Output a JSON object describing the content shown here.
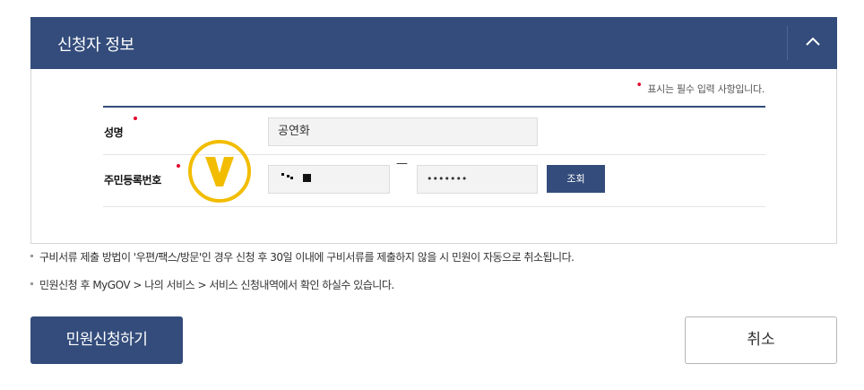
{
  "section": {
    "title": "신청자 정보",
    "collapse_icon": "chevron-up-icon"
  },
  "form": {
    "required_note": "표시는 필수 입력 사항입니다.",
    "name_label": "성명",
    "name_value": "공연화",
    "rrn_label": "주민등록번호",
    "rrn_separator": "—",
    "rrn_back_value": "•••••••",
    "lookup_button": "조회"
  },
  "badge": {
    "icon": "v-check-badge-icon",
    "letter": "V",
    "color": "#f2bd00"
  },
  "notices": [
    "구비서류 제출 방법이 '우편/팩스/방문'인 경우 신청 후 30일 이내에 구비서류를 제출하지 않을 시 민원이 자동으로 취소됩니다.",
    "민원신청 후 MyGOV > 나의 서비스 > 서비스 신청내역에서 확인 하실수 있습니다."
  ],
  "actions": {
    "apply_label": "민원신청하기",
    "cancel_label": "취소"
  },
  "colors": {
    "primary": "#334c7b",
    "required": "#e4002b",
    "field_bg": "#f3f3f3"
  }
}
